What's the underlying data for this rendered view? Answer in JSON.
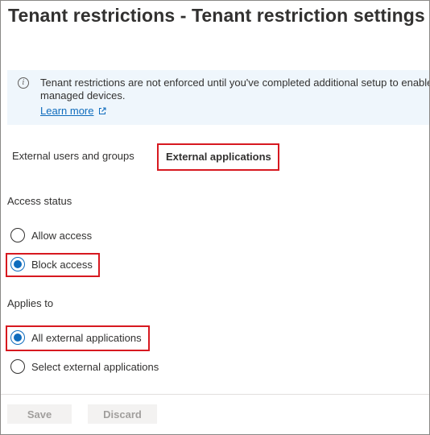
{
  "header": {
    "title": "Tenant restrictions - Tenant restriction settings"
  },
  "info_banner": {
    "icon": "info-icon",
    "line1": "Tenant restrictions are not enforced until you've completed additional setup to enable",
    "line2": "managed devices.",
    "link_label": "Learn more",
    "link_icon": "external-link-icon"
  },
  "tabs": [
    {
      "label": "External users and groups",
      "selected": false
    },
    {
      "label": "External applications",
      "selected": true
    }
  ],
  "access_status": {
    "label": "Access status",
    "options": [
      {
        "label": "Allow access",
        "checked": false
      },
      {
        "label": "Block access",
        "checked": true
      }
    ]
  },
  "applies_to": {
    "label": "Applies to",
    "options": [
      {
        "label": "All external applications",
        "checked": true
      },
      {
        "label": "Select external applications",
        "checked": false
      }
    ]
  },
  "footer": {
    "save_label": "Save",
    "discard_label": "Discard"
  },
  "colors": {
    "accent": "#0f6cbd",
    "highlight": "#d71920",
    "banner_bg": "#eff6fc",
    "disabled_button_bg": "#f3f2f1"
  }
}
